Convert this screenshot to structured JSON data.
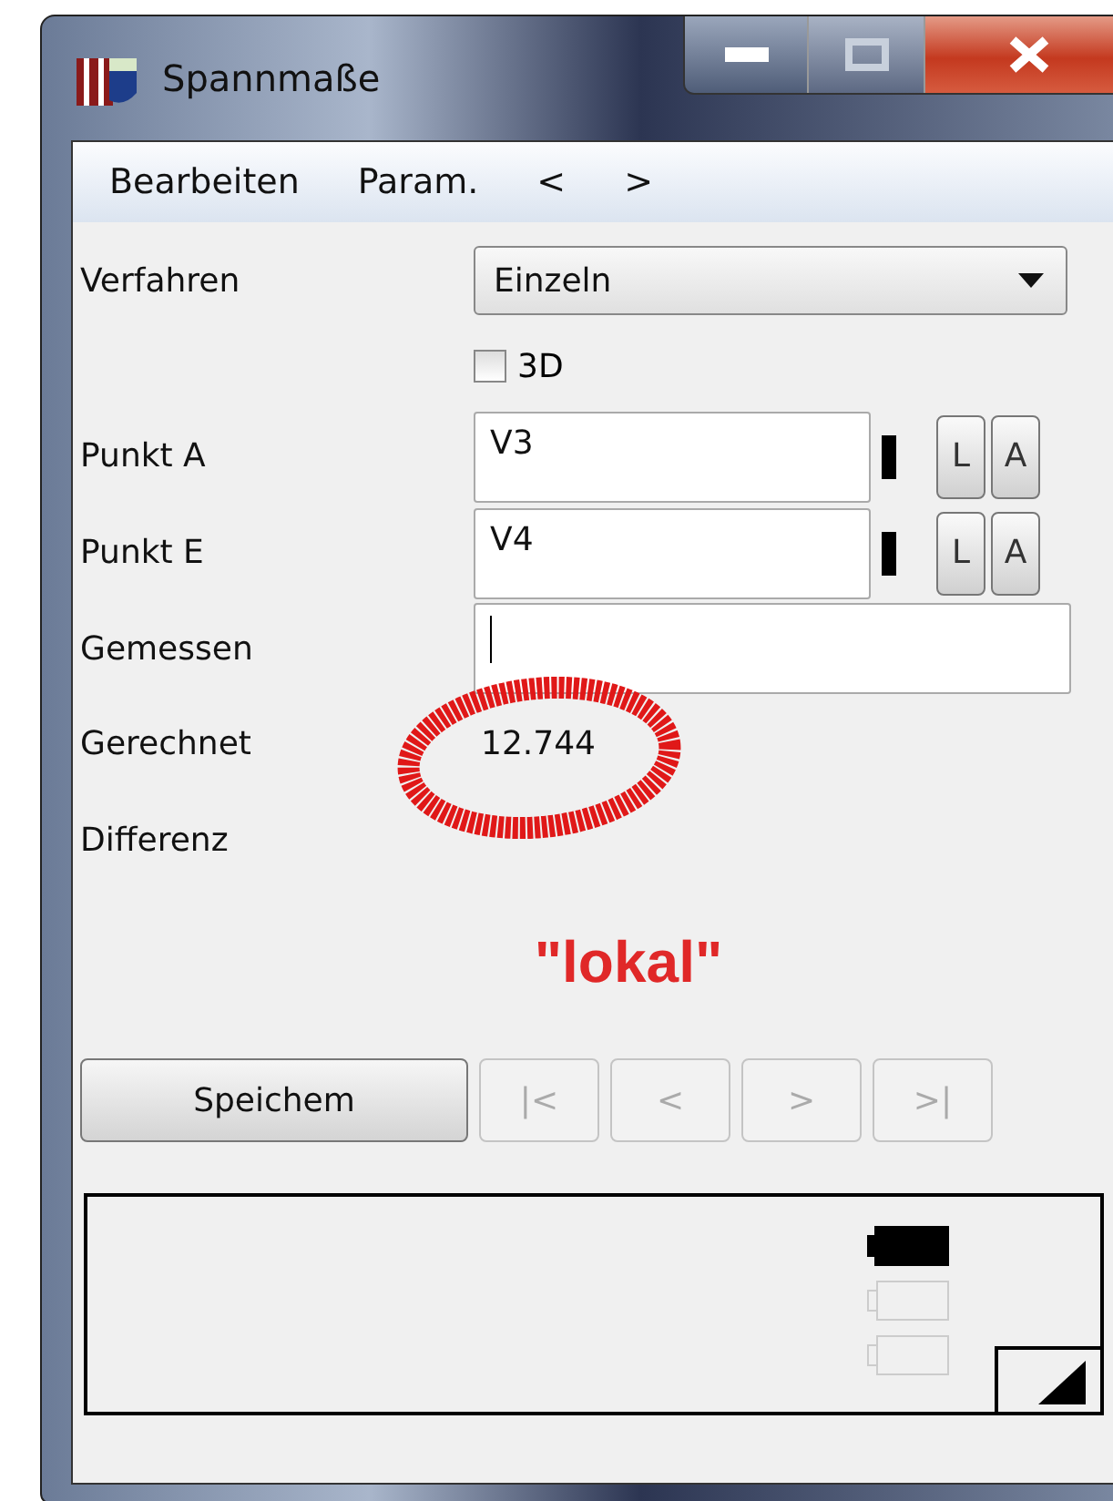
{
  "window": {
    "title": "Spannmaße"
  },
  "menu": [
    {
      "label": "Bearbeiten"
    },
    {
      "label": "Param."
    },
    {
      "label": "<"
    },
    {
      "label": ">"
    }
  ],
  "fields": [
    {
      "kind": "dropdown",
      "label": "Verfahren",
      "value": "Einzeln"
    },
    {
      "kind": "checkbox",
      "label": "3D",
      "checked": false
    },
    {
      "kind": "point",
      "label": "Punkt A",
      "value": "V3",
      "buttons": [
        "L",
        "A"
      ]
    },
    {
      "kind": "point",
      "label": "Punkt E",
      "value": "V4",
      "buttons": [
        "L",
        "A"
      ]
    },
    {
      "kind": "input",
      "label": "Gemessen",
      "focused": true
    },
    {
      "kind": "readout",
      "label": "Gerechnet",
      "value": "12.744",
      "circled": true
    },
    {
      "kind": "readout",
      "label": "Differenz"
    }
  ],
  "annotation": {
    "text": "\"lokal\""
  },
  "save_button": {
    "label": "Speichem"
  },
  "nav_buttons": [
    {
      "label": "|<",
      "disabled": true
    },
    {
      "label": "<",
      "disabled": true
    },
    {
      "label": ">",
      "disabled": true
    },
    {
      "label": ">|",
      "disabled": true
    }
  ],
  "status": {
    "batteries": [
      {
        "filled": true
      },
      {
        "filled": false
      },
      {
        "filled": false
      }
    ]
  }
}
